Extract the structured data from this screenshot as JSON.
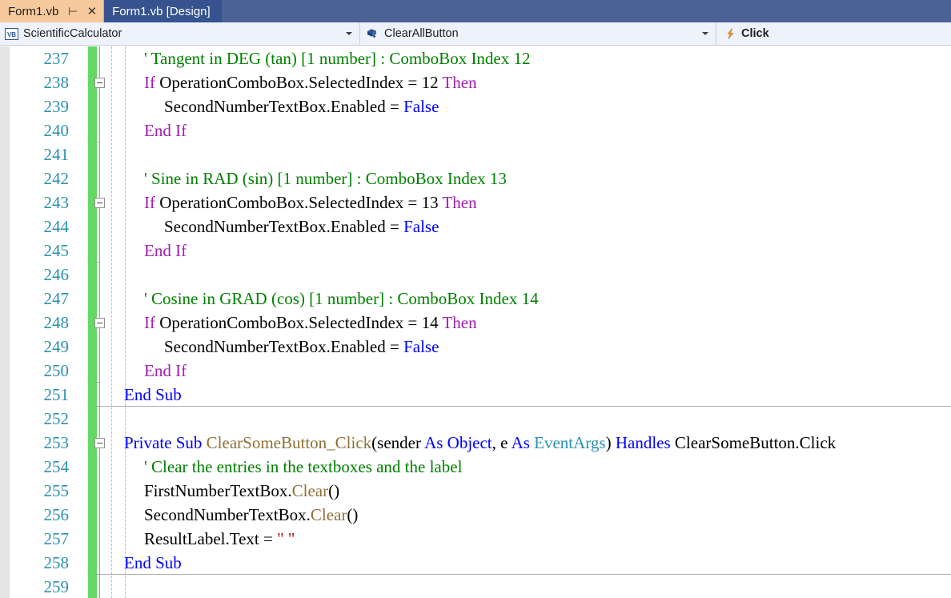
{
  "tabs": [
    {
      "label": "Form1.vb",
      "active": true,
      "pin_icon": "pin-icon",
      "close_icon": "close-icon",
      "pin_glyph": "⊣",
      "close_glyph": "✕"
    },
    {
      "label": "Form1.vb [Design]",
      "active": false
    }
  ],
  "navbar": {
    "type_combo": {
      "icon": "vb-project-icon",
      "icon_text": "VB",
      "value": "ScientificCalculator"
    },
    "member_combo": {
      "icon": "event-member-icon",
      "value": "ClearAllButton"
    },
    "event_combo": {
      "icon": "lightning-event-icon",
      "value": "Click"
    }
  },
  "editor": {
    "first_line_number": 237,
    "lines": [
      {
        "n": 237,
        "indent": 1,
        "tokens": [
          {
            "t": "' Tangent in DEG (tan) [1 number] : ComboBox Index 12",
            "c": "cmt"
          }
        ]
      },
      {
        "n": 238,
        "indent": 1,
        "collapse": true,
        "tokens": [
          {
            "t": "If ",
            "c": "kwp"
          },
          {
            "t": "OperationComboBox.SelectedIndex = 12 ",
            "c": "num"
          },
          {
            "t": "Then",
            "c": "kwp"
          }
        ]
      },
      {
        "n": 239,
        "indent": 2,
        "tokens": [
          {
            "t": "SecondNumberTextBox.Enabled = ",
            "c": "num"
          },
          {
            "t": "False",
            "c": "kw"
          }
        ]
      },
      {
        "n": 240,
        "indent": 1,
        "tokens": [
          {
            "t": "End If",
            "c": "kwp"
          }
        ]
      },
      {
        "n": 241,
        "indent": 1,
        "tokens": []
      },
      {
        "n": 242,
        "indent": 1,
        "tokens": [
          {
            "t": "' Sine in RAD (sin) [1 number] : ComboBox Index 13",
            "c": "cmt"
          }
        ]
      },
      {
        "n": 243,
        "indent": 1,
        "collapse": true,
        "tokens": [
          {
            "t": "If ",
            "c": "kwp"
          },
          {
            "t": "OperationComboBox.SelectedIndex = 13 ",
            "c": "num"
          },
          {
            "t": "Then",
            "c": "kwp"
          }
        ]
      },
      {
        "n": 244,
        "indent": 2,
        "tokens": [
          {
            "t": "SecondNumberTextBox.Enabled = ",
            "c": "num"
          },
          {
            "t": "False",
            "c": "kw"
          }
        ]
      },
      {
        "n": 245,
        "indent": 1,
        "tokens": [
          {
            "t": "End If",
            "c": "kwp"
          }
        ]
      },
      {
        "n": 246,
        "indent": 1,
        "tokens": []
      },
      {
        "n": 247,
        "indent": 1,
        "tokens": [
          {
            "t": "' Cosine in GRAD (cos) [1 number] : ComboBox Index 14",
            "c": "cmt"
          }
        ]
      },
      {
        "n": 248,
        "indent": 1,
        "collapse": true,
        "tokens": [
          {
            "t": "If ",
            "c": "kwp"
          },
          {
            "t": "OperationComboBox.SelectedIndex = 14 ",
            "c": "num"
          },
          {
            "t": "Then",
            "c": "kwp"
          }
        ]
      },
      {
        "n": 249,
        "indent": 2,
        "tokens": [
          {
            "t": "SecondNumberTextBox.Enabled = ",
            "c": "num"
          },
          {
            "t": "False",
            "c": "kw"
          }
        ]
      },
      {
        "n": 250,
        "indent": 1,
        "tokens": [
          {
            "t": "End If",
            "c": "kwp"
          }
        ]
      },
      {
        "n": 251,
        "indent": 0,
        "separator_after": true,
        "tokens": [
          {
            "t": "End Sub",
            "c": "kw"
          }
        ]
      },
      {
        "n": 252,
        "indent": 0,
        "tokens": []
      },
      {
        "n": 253,
        "indent": 0,
        "collapse": true,
        "tokens": [
          {
            "t": "Private Sub ",
            "c": "kw"
          },
          {
            "t": "ClearSomeButton_Click",
            "c": "method"
          },
          {
            "t": "(sender ",
            "c": "num"
          },
          {
            "t": "As ",
            "c": "kw"
          },
          {
            "t": "Object",
            "c": "kw"
          },
          {
            "t": ", e ",
            "c": "num"
          },
          {
            "t": "As ",
            "c": "kw"
          },
          {
            "t": "EventArgs",
            "c": "type"
          },
          {
            "t": ") ",
            "c": "num"
          },
          {
            "t": "Handles ",
            "c": "kw"
          },
          {
            "t": "ClearSomeButton.Click",
            "c": "num"
          }
        ]
      },
      {
        "n": 254,
        "indent": 1,
        "tokens": [
          {
            "t": "' Clear the entries in the textboxes and the label",
            "c": "cmt"
          }
        ]
      },
      {
        "n": 255,
        "indent": 1,
        "tokens": [
          {
            "t": "FirstNumberTextBox.",
            "c": "num"
          },
          {
            "t": "Clear",
            "c": "method"
          },
          {
            "t": "()",
            "c": "num"
          }
        ]
      },
      {
        "n": 256,
        "indent": 1,
        "tokens": [
          {
            "t": "SecondNumberTextBox.",
            "c": "num"
          },
          {
            "t": "Clear",
            "c": "method"
          },
          {
            "t": "()",
            "c": "num"
          }
        ]
      },
      {
        "n": 257,
        "indent": 1,
        "tokens": [
          {
            "t": "ResultLabel.Text = ",
            "c": "num"
          },
          {
            "t": "\" \"",
            "c": "str"
          }
        ]
      },
      {
        "n": 258,
        "indent": 0,
        "separator_after": true,
        "tokens": [
          {
            "t": "End Sub",
            "c": "kw"
          }
        ]
      },
      {
        "n": 259,
        "indent": 0,
        "tokens": []
      }
    ]
  },
  "colors": {
    "tab_active_bg": "#f6ca9c",
    "tab_inactive_bg": "#36538f",
    "tab_strip_bg": "#4c6294",
    "navbar_bg": "#eef2fa",
    "line_number": "#2b91af",
    "comment": "#008000",
    "keyword_blue": "#0000ff",
    "keyword_purple": "#a020b0",
    "string": "#a31515",
    "type": "#2b91af",
    "method": "#8f7137",
    "change_bar": "#63da63"
  }
}
